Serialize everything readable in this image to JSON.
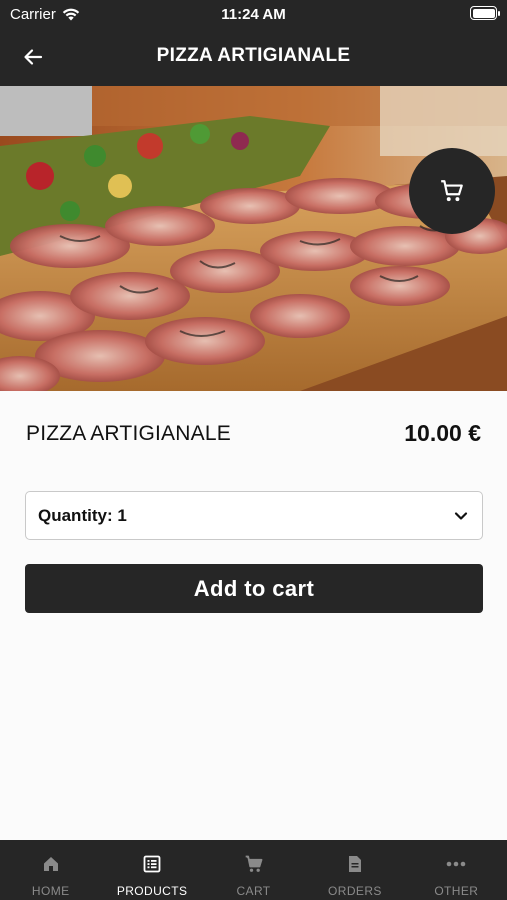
{
  "status_bar": {
    "carrier": "Carrier",
    "time": "11:24 AM"
  },
  "nav": {
    "title": "PIZZA ARTIGIANALE"
  },
  "product": {
    "name": "PIZZA ARTIGIANALE",
    "price": "10.00 €"
  },
  "quantity": {
    "label": "Quantity: 1"
  },
  "add_to_cart": {
    "label": "Add to cart"
  },
  "tabs": [
    {
      "label": "HOME",
      "icon": "home-icon",
      "active": false
    },
    {
      "label": "PRODUCTS",
      "icon": "list-icon",
      "active": true
    },
    {
      "label": "CART",
      "icon": "cart-icon",
      "active": false
    },
    {
      "label": "ORDERS",
      "icon": "document-icon",
      "active": false
    },
    {
      "label": "OTHER",
      "icon": "more-icon",
      "active": false
    }
  ],
  "colors": {
    "bar": "#262626",
    "background": "#fbfbfb",
    "inactive_tab": "#8a8a8a"
  }
}
